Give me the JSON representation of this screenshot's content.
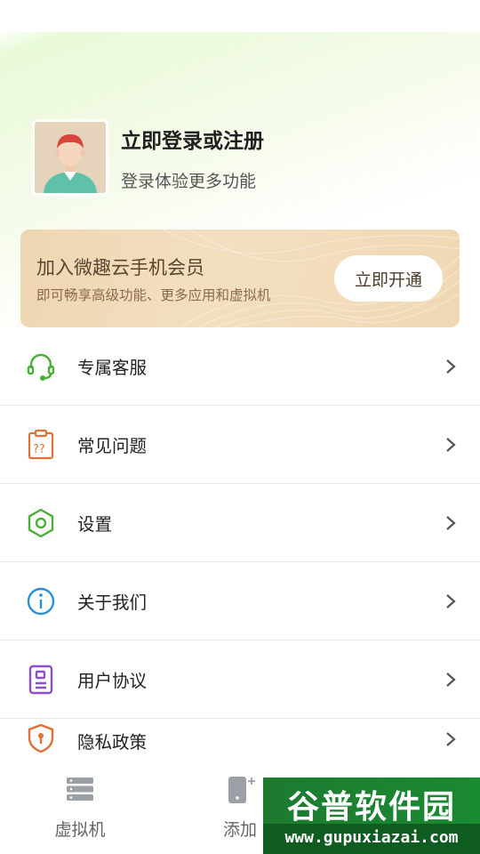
{
  "profile": {
    "title": "立即登录或注册",
    "subtitle": "登录体验更多功能"
  },
  "vip": {
    "title": "加入微趣云手机会员",
    "subtitle": "即可畅享高级功能、更多应用和虚拟机",
    "button_label": "立即开通"
  },
  "menu": {
    "items": [
      {
        "label": "专属客服",
        "icon": "headset-icon",
        "color": "#4aae3a"
      },
      {
        "label": "常见问题",
        "icon": "faq-clipboard-icon",
        "color": "#e0703a"
      },
      {
        "label": "设置",
        "icon": "settings-hexagon-icon",
        "color": "#4aae3a"
      },
      {
        "label": "关于我们",
        "icon": "info-icon",
        "color": "#2d8fd6"
      },
      {
        "label": "用户协议",
        "icon": "agreement-icon",
        "color": "#8a4fc9"
      },
      {
        "label": "隐私政策",
        "icon": "privacy-shield-icon",
        "color": "#e0703a"
      }
    ]
  },
  "tabbar": {
    "tabs": [
      {
        "label": "虚拟机",
        "icon": "server-icon"
      },
      {
        "label": "添加",
        "icon": "add-device-icon"
      }
    ]
  },
  "watermark": {
    "title": "谷普软件园",
    "url": "www.gupuxiazai.com"
  },
  "colors": {
    "accent_green": "#4aae3a",
    "vip_gold": "#f0d8b4",
    "divider": "#e6e6e6"
  }
}
